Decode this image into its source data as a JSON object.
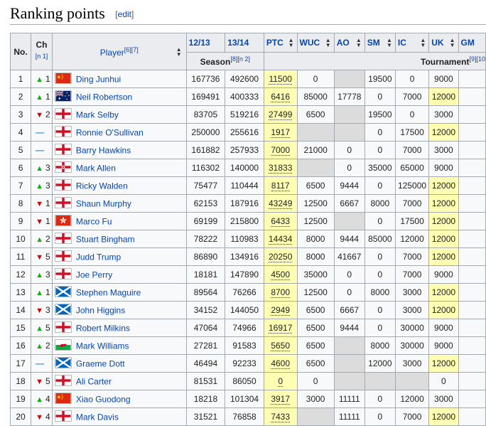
{
  "section": {
    "title": "Ranking points",
    "edit_label": "edit"
  },
  "header": {
    "no": "No.",
    "ch": "Ch",
    "ch_note": "[n 1]",
    "player": "Player",
    "player_note": "[6][7]",
    "cols": [
      "12/13",
      "13/14",
      "PTC",
      "WUC",
      "AO",
      "SM",
      "IC",
      "UK",
      "GM"
    ],
    "season": "Season",
    "season_note": "[8][n 2]",
    "tournament": "Tournament",
    "tournament_note": "[9][10"
  },
  "colors": {
    "up": "#10b010",
    "down": "#d00000",
    "same": "#3a8fd8",
    "highlight": "#ffffb3",
    "empty": "#dcdcdc"
  },
  "rows": [
    {
      "no": "1",
      "dir": "up",
      "ch": "1",
      "flag": "china-flag",
      "player": "Ding Junhui",
      "s1213": "167736",
      "s1314": "492600",
      "ptc": "11500",
      "wuc": "0",
      "ao": "",
      "sm": "19500",
      "ic": "0",
      "uk": "9000",
      "uk_hl": false,
      "gm": ""
    },
    {
      "no": "2",
      "dir": "up",
      "ch": "1",
      "flag": "australia-flag",
      "player": "Neil Robertson",
      "s1213": "169491",
      "s1314": "400333",
      "ptc": "6416",
      "wuc": "85000",
      "ao": "17778",
      "sm": "0",
      "ic": "7000",
      "uk": "12000",
      "uk_hl": true,
      "gm": ""
    },
    {
      "no": "3",
      "dir": "down",
      "ch": "2",
      "flag": "england-flag",
      "player": "Mark Selby",
      "s1213": "83705",
      "s1314": "519216",
      "ptc": "27499",
      "wuc": "6500",
      "ao": "",
      "sm": "19500",
      "ic": "0",
      "uk": "3000",
      "uk_hl": false,
      "gm": ""
    },
    {
      "no": "4",
      "dir": "same",
      "ch": "",
      "flag": "england-flag",
      "player": "Ronnie O'Sullivan",
      "s1213": "250000",
      "s1314": "255616",
      "ptc": "1917",
      "wuc": "",
      "ao": "",
      "sm": "0",
      "ic": "17500",
      "uk": "12000",
      "uk_hl": true,
      "gm": ""
    },
    {
      "no": "5",
      "dir": "same",
      "ch": "",
      "flag": "england-flag",
      "player": "Barry Hawkins",
      "s1213": "161882",
      "s1314": "257933",
      "ptc": "7000",
      "wuc": "21000",
      "ao": "0",
      "sm": "0",
      "ic": "7000",
      "uk": "3000",
      "uk_hl": false,
      "gm": ""
    },
    {
      "no": "6",
      "dir": "up",
      "ch": "3",
      "flag": "northern-ireland-flag",
      "player": "Mark Allen",
      "s1213": "116302",
      "s1314": "140000",
      "ptc": "31833",
      "wuc": "",
      "ao": "0",
      "sm": "35000",
      "ic": "65000",
      "uk": "9000",
      "uk_hl": false,
      "gm": ""
    },
    {
      "no": "7",
      "dir": "up",
      "ch": "3",
      "flag": "england-flag",
      "player": "Ricky Walden",
      "s1213": "75477",
      "s1314": "110444",
      "ptc": "8117",
      "wuc": "6500",
      "ao": "9444",
      "sm": "0",
      "ic": "125000",
      "uk": "12000",
      "uk_hl": true,
      "gm": ""
    },
    {
      "no": "8",
      "dir": "down",
      "ch": "1",
      "flag": "england-flag",
      "player": "Shaun Murphy",
      "s1213": "62153",
      "s1314": "187916",
      "ptc": "43249",
      "wuc": "12500",
      "ao": "6667",
      "sm": "8000",
      "ic": "7000",
      "uk": "12000",
      "uk_hl": true,
      "gm": ""
    },
    {
      "no": "9",
      "dir": "down",
      "ch": "1",
      "flag": "hong-kong-flag",
      "player": "Marco Fu",
      "s1213": "69199",
      "s1314": "215800",
      "ptc": "6433",
      "wuc": "12500",
      "ao": "",
      "sm": "0",
      "ic": "17500",
      "uk": "12000",
      "uk_hl": true,
      "gm": ""
    },
    {
      "no": "10",
      "dir": "up",
      "ch": "2",
      "flag": "england-flag",
      "player": "Stuart Bingham",
      "s1213": "78222",
      "s1314": "110983",
      "ptc": "14434",
      "wuc": "8000",
      "ao": "9444",
      "sm": "85000",
      "ic": "12000",
      "uk": "12000",
      "uk_hl": true,
      "gm": ""
    },
    {
      "no": "11",
      "dir": "down",
      "ch": "5",
      "flag": "england-flag",
      "player": "Judd Trump",
      "s1213": "86890",
      "s1314": "134916",
      "ptc": "20250",
      "wuc": "8000",
      "ao": "41667",
      "sm": "0",
      "ic": "7000",
      "uk": "12000",
      "uk_hl": true,
      "gm": ""
    },
    {
      "no": "12",
      "dir": "up",
      "ch": "3",
      "flag": "england-flag",
      "player": "Joe Perry",
      "s1213": "18181",
      "s1314": "147890",
      "ptc": "4500",
      "wuc": "35000",
      "ao": "0",
      "sm": "0",
      "ic": "7000",
      "uk": "9000",
      "uk_hl": false,
      "gm": ""
    },
    {
      "no": "13",
      "dir": "up",
      "ch": "1",
      "flag": "scotland-flag",
      "player": "Stephen Maguire",
      "s1213": "89564",
      "s1314": "76266",
      "ptc": "8700",
      "wuc": "12500",
      "ao": "0",
      "sm": "8000",
      "ic": "3000",
      "uk": "12000",
      "uk_hl": true,
      "gm": ""
    },
    {
      "no": "14",
      "dir": "down",
      "ch": "3",
      "flag": "scotland-flag",
      "player": "John Higgins",
      "s1213": "34152",
      "s1314": "144050",
      "ptc": "2949",
      "wuc": "6500",
      "ao": "6667",
      "sm": "0",
      "ic": "3000",
      "uk": "12000",
      "uk_hl": true,
      "gm": ""
    },
    {
      "no": "15",
      "dir": "up",
      "ch": "5",
      "flag": "england-flag",
      "player": "Robert Milkins",
      "s1213": "47064",
      "s1314": "74966",
      "ptc": "16917",
      "wuc": "6500",
      "ao": "9444",
      "sm": "0",
      "ic": "30000",
      "uk": "9000",
      "uk_hl": false,
      "gm": ""
    },
    {
      "no": "16",
      "dir": "up",
      "ch": "2",
      "flag": "wales-flag",
      "player": "Mark Williams",
      "s1213": "27281",
      "s1314": "91583",
      "ptc": "5650",
      "wuc": "6500",
      "ao": "",
      "sm": "8000",
      "ic": "30000",
      "uk": "9000",
      "uk_hl": false,
      "gm": ""
    },
    {
      "no": "17",
      "dir": "same",
      "ch": "",
      "flag": "scotland-flag",
      "player": "Graeme Dott",
      "s1213": "46494",
      "s1314": "92233",
      "ptc": "4600",
      "wuc": "6500",
      "ao": "",
      "sm": "12000",
      "ic": "3000",
      "uk": "12000",
      "uk_hl": true,
      "gm": ""
    },
    {
      "no": "18",
      "dir": "down",
      "ch": "5",
      "flag": "england-flag",
      "player": "Ali Carter",
      "s1213": "81531",
      "s1314": "86050",
      "ptc": "0",
      "wuc": "0",
      "ao": "",
      "sm": "",
      "ic": "",
      "uk": "0",
      "uk_hl": false,
      "gm": ""
    },
    {
      "no": "19",
      "dir": "up",
      "ch": "4",
      "flag": "china-flag",
      "player": "Xiao Guodong",
      "s1213": "18218",
      "s1314": "101304",
      "ptc": "3917",
      "wuc": "3000",
      "ao": "11111",
      "sm": "0",
      "ic": "12000",
      "uk": "3000",
      "uk_hl": false,
      "gm": ""
    },
    {
      "no": "20",
      "dir": "down",
      "ch": "4",
      "flag": "england-flag",
      "player": "Mark Davis",
      "s1213": "31521",
      "s1314": "76858",
      "ptc": "7433",
      "wuc": "",
      "ao": "11111",
      "sm": "0",
      "ic": "7000",
      "uk": "12000",
      "uk_hl": true,
      "gm": ""
    }
  ]
}
